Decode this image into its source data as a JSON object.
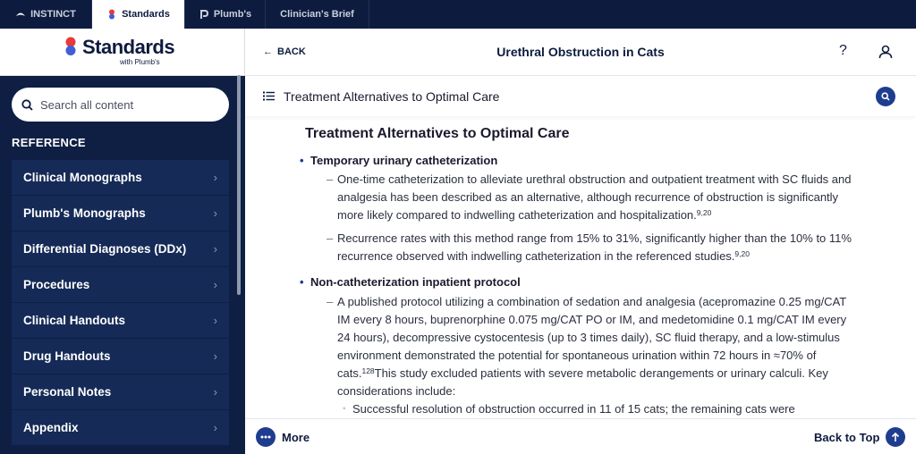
{
  "product_tabs": [
    {
      "label": "INSTINCT",
      "active": false
    },
    {
      "label": "Standards",
      "active": true
    },
    {
      "label": "Plumb's",
      "active": false
    },
    {
      "label": "Clinician's Brief",
      "active": false
    }
  ],
  "brand": {
    "name": "Standards",
    "subtitle": "with Plumb's"
  },
  "search": {
    "placeholder": "Search all content"
  },
  "sidebar": {
    "section_title": "REFERENCE",
    "items": [
      {
        "label": "Clinical Monographs"
      },
      {
        "label": "Plumb's Monographs"
      },
      {
        "label": "Differential Diagnoses (DDx)"
      },
      {
        "label": "Procedures"
      },
      {
        "label": "Clinical Handouts"
      },
      {
        "label": "Drug Handouts"
      },
      {
        "label": "Personal Notes"
      },
      {
        "label": "Appendix"
      }
    ]
  },
  "header": {
    "back_label": "BACK",
    "title": "Urethral Obstruction in Cats"
  },
  "section_bar": {
    "title": "Treatment Alternatives to Optimal Care"
  },
  "article": {
    "heading": "Treatment Alternatives to Optimal Care",
    "bullet1": "Temporary urinary catheterization",
    "b1_sub1": "One-time catheterization to alleviate urethral obstruction and outpatient treatment with SC fluids and analgesia has been described as an alternative, although recurrence of obstruction is significantly more likely compared to indwelling catheterization and hospitalization.",
    "b1_sub1_ref": "9,20",
    "b1_sub2": "Recurrence rates with this method range from 15% to 31%, significantly higher than the 10% to 11% recurrence observed with indwelling catheterization in the referenced studies.",
    "b1_sub2_ref": "9,20",
    "bullet2": "Non-catheterization inpatient protocol",
    "b2_sub1_a": "A published protocol utilizing a combination of sedation and analgesia (acepromazine 0.25 mg/CAT IM every 8 hours, buprenorphine 0.075 mg/CAT PO or IM, and medetomidine 0.1 mg/CAT IM every 24 hours), decompressive cystocentesis (up to 3 times daily), SC fluid therapy, and a low-stimulus environment demonstrated the potential for spontaneous urination within 72 hours in ≈70% of cats.",
    "b2_sub1_ref": "128",
    "b2_sub1_b": "This study excluded patients with severe metabolic derangements or urinary calculi. Key considerations include:",
    "b2_subsub1": "Successful resolution of obstruction occurred in 11 of 15 cats; the remaining cats were"
  },
  "footer": {
    "more_label": "More",
    "top_label": "Back to Top"
  }
}
